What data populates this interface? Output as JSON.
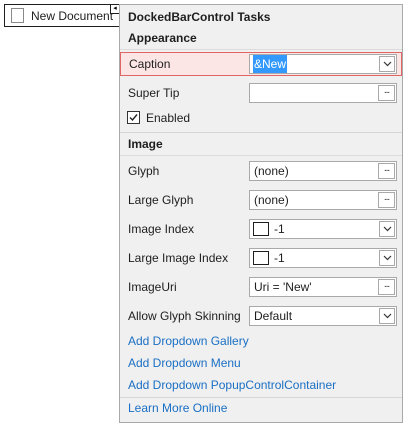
{
  "designer_item": {
    "label": "New Document",
    "icon": "document-icon",
    "smart_tag_glyph": "◂"
  },
  "panel": {
    "title": "DockedBarControl Tasks",
    "appearance": {
      "header": "Appearance",
      "caption": {
        "label": "Caption",
        "value": "&New"
      },
      "super_tip": {
        "label": "Super Tip",
        "value": ""
      },
      "enabled": {
        "label": "Enabled",
        "checked": true
      }
    },
    "image": {
      "header": "Image",
      "glyph": {
        "label": "Glyph",
        "value": "(none)"
      },
      "large_glyph": {
        "label": "Large Glyph",
        "value": "(none)"
      },
      "image_index": {
        "label": "Image Index",
        "value": "-1"
      },
      "large_image_index": {
        "label": "Large Image Index",
        "value": "-1"
      },
      "image_uri": {
        "label": "ImageUri",
        "value": "Uri = 'New'"
      },
      "allow_glyph_skinning": {
        "label": "Allow Glyph Skinning",
        "value": "Default"
      }
    },
    "links": {
      "add_dropdown_gallery": "Add Dropdown Gallery",
      "add_dropdown_menu": "Add Dropdown Menu",
      "add_dropdown_popup": "Add Dropdown PopupControlContainer",
      "learn_more": "Learn More Online"
    },
    "ellipsis": "...",
    "check_glyph": "✓"
  },
  "colors": {
    "highlight_bg": "#fbe5e5",
    "highlight_border": "#e06666",
    "selection": "#3399ff",
    "link": "#1a6fc4",
    "panel_bg": "#f0f0f0"
  }
}
